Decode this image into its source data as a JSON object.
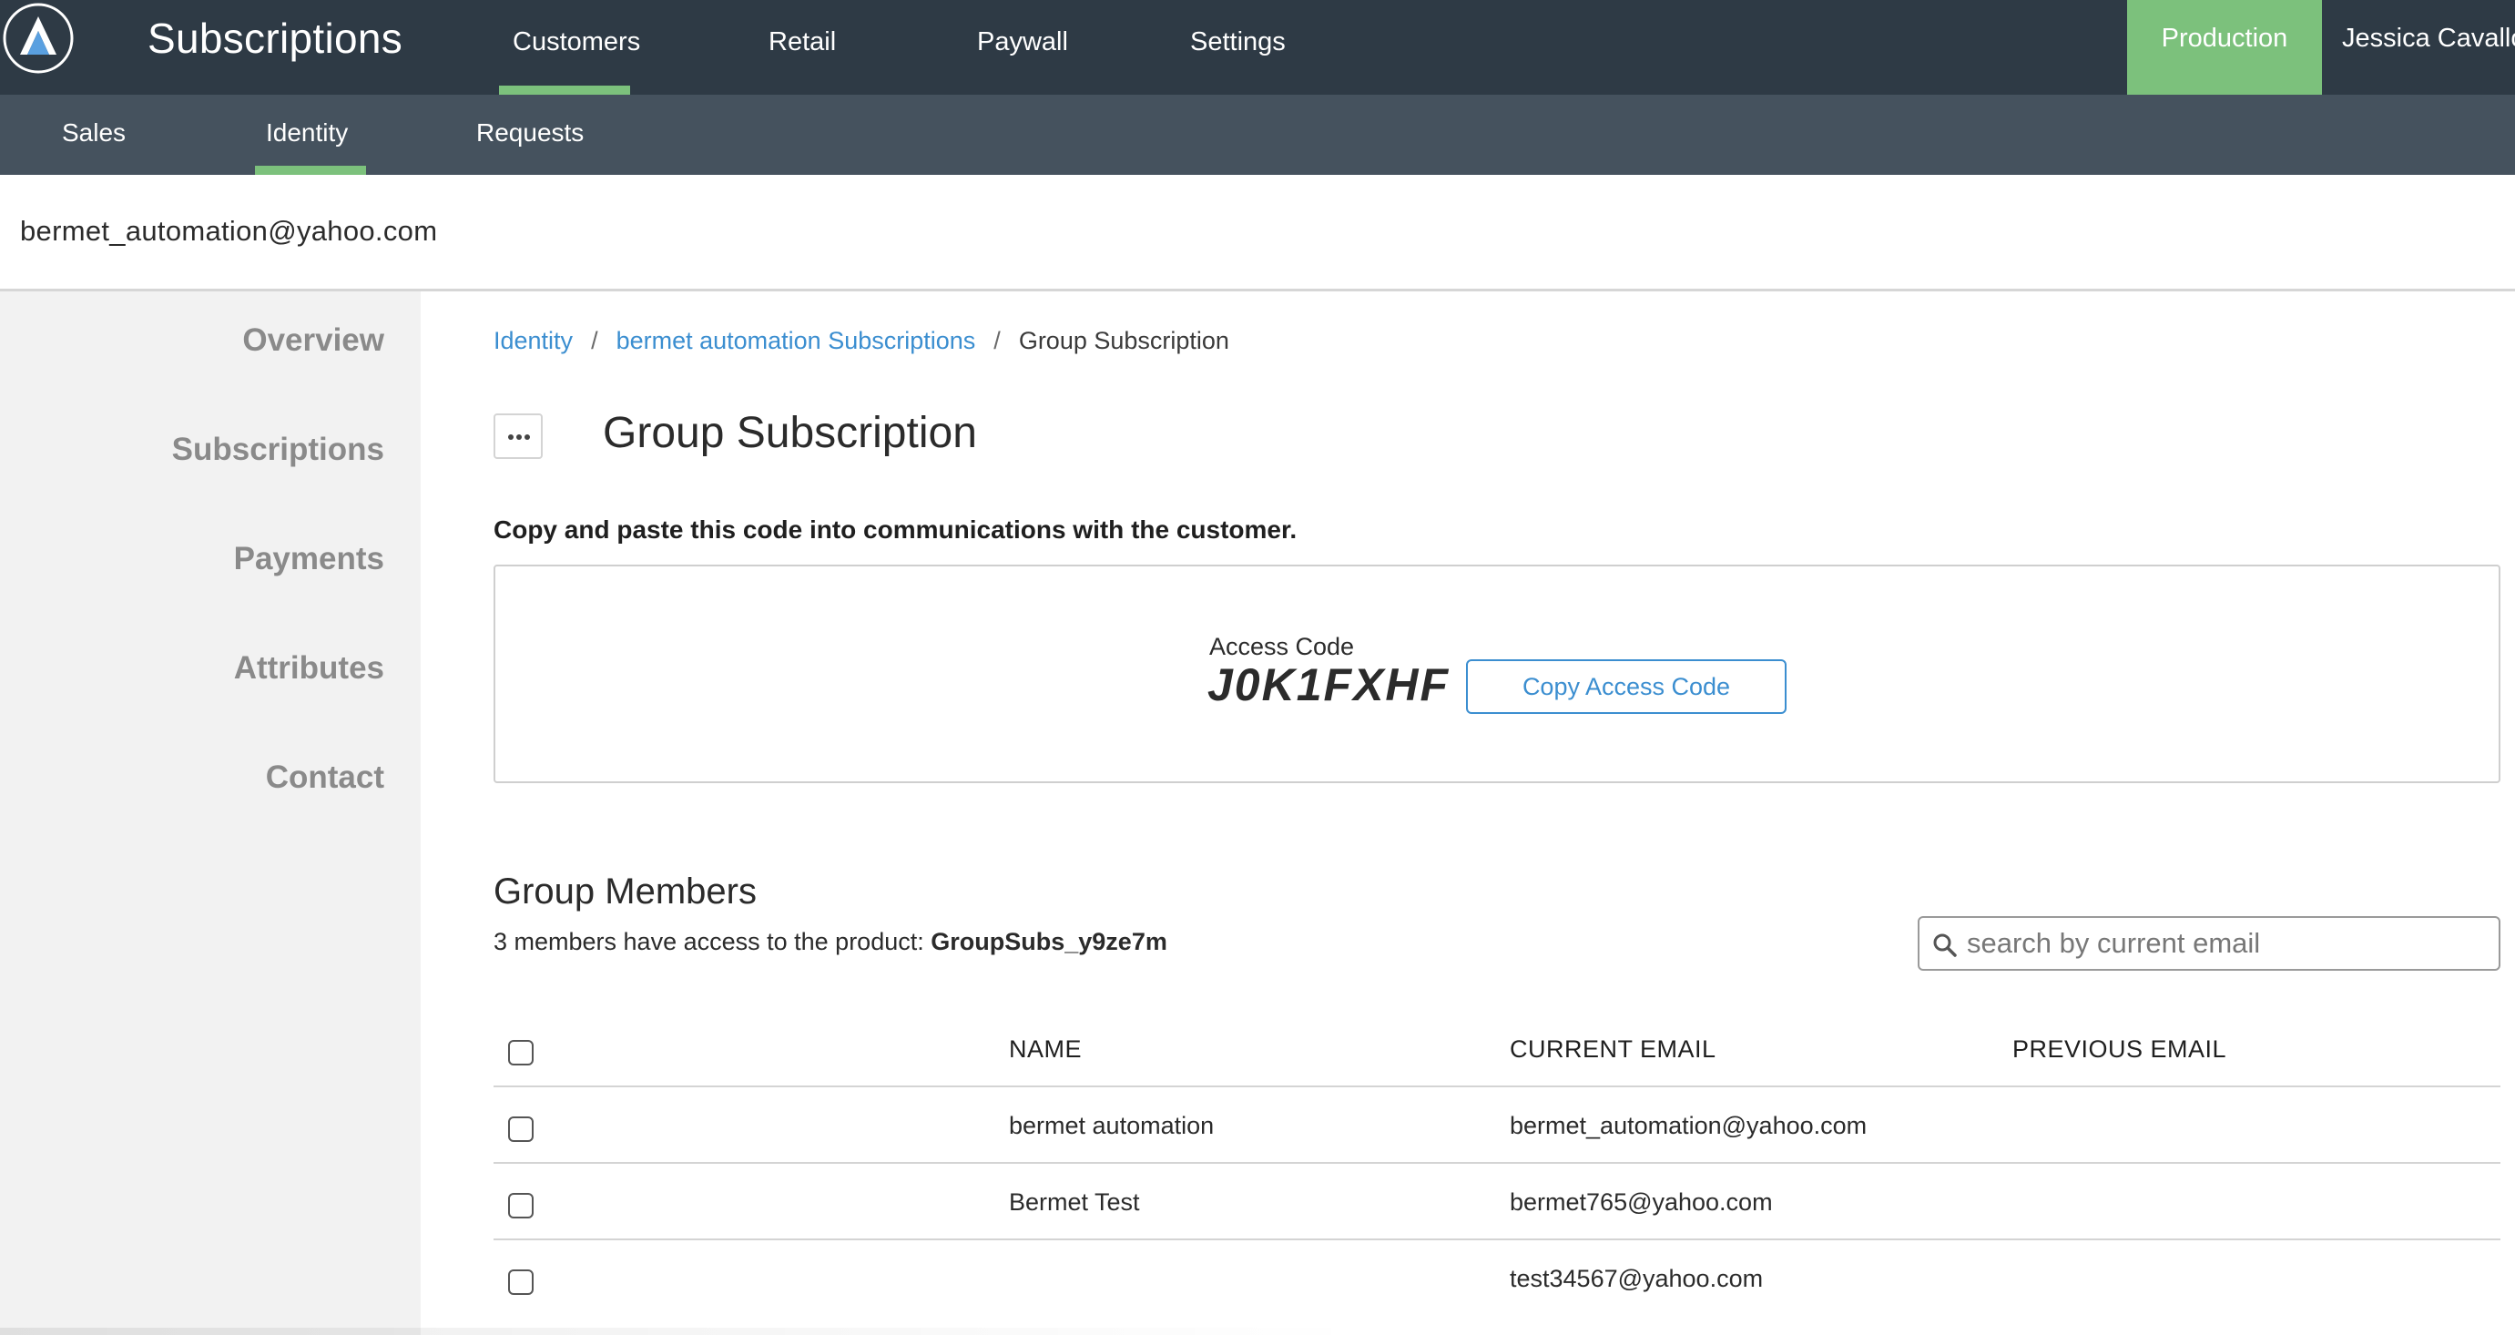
{
  "app": {
    "title": "Subscriptions",
    "logo_icon": "brand-logo-icon"
  },
  "topnav": {
    "items": [
      {
        "label": "Customers",
        "active": true
      },
      {
        "label": "Retail",
        "active": false
      },
      {
        "label": "Paywall",
        "active": false
      },
      {
        "label": "Settings",
        "active": false
      }
    ],
    "environment": "Production",
    "user": "Jessica Cavallo"
  },
  "subnav": {
    "items": [
      {
        "label": "Sales",
        "active": false
      },
      {
        "label": "Identity",
        "active": true
      },
      {
        "label": "Requests",
        "active": false
      }
    ]
  },
  "identity": {
    "email": "bermet_automation@yahoo.com"
  },
  "sidebar": {
    "items": [
      {
        "label": "Overview"
      },
      {
        "label": "Subscriptions"
      },
      {
        "label": "Payments"
      },
      {
        "label": "Attributes"
      },
      {
        "label": "Contact"
      }
    ]
  },
  "breadcrumb": {
    "items": [
      {
        "label": "Identity"
      },
      {
        "label": "bermet automation Subscriptions"
      },
      {
        "label": "Group Subscription"
      }
    ],
    "separator": "/"
  },
  "page": {
    "title": "Group Subscription",
    "more_icon": "ellipsis-icon",
    "instruction": "Copy and paste this code into communications with the customer."
  },
  "access_code": {
    "label": "Access Code",
    "value": "J0K1FXHF",
    "copy_label": "Copy Access Code"
  },
  "members": {
    "title": "Group Members",
    "summary_prefix": "3 members have access to the product:",
    "product": "GroupSubs_y9ze7m",
    "search_placeholder": "search by current email",
    "columns": [
      "NAME",
      "CURRENT EMAIL",
      "PREVIOUS EMAIL"
    ],
    "rows": [
      {
        "name": "bermet automation",
        "current_email": "bermet_automation@yahoo.com",
        "previous_email": ""
      },
      {
        "name": "Bermet Test",
        "current_email": "bermet765@yahoo.com",
        "previous_email": ""
      },
      {
        "name": "",
        "current_email": "test34567@yahoo.com",
        "previous_email": ""
      }
    ]
  },
  "colors": {
    "topbar": "#2e3a45",
    "subbar": "#45525e",
    "accent_green": "#7cc17c",
    "link_blue": "#3b8ed0",
    "sidebar_bg": "#f2f2f2"
  }
}
